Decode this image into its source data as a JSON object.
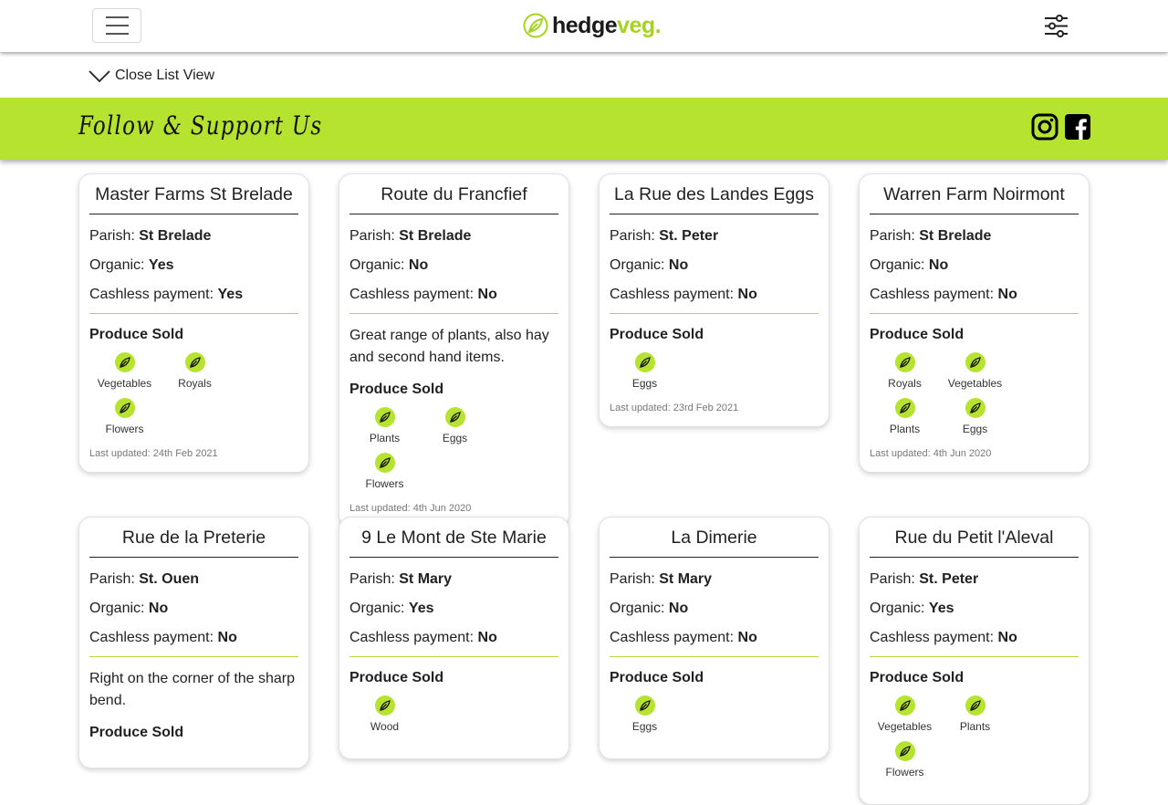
{
  "brand": {
    "hedge": "hedge",
    "veg": "veg."
  },
  "list_toggle": "Close List View",
  "follow": {
    "title": "Follow & Support Us"
  },
  "labels": {
    "parish": "Parish: ",
    "organic": "Organic: ",
    "cashless": "Cashless payment: ",
    "produce": "Produce Sold"
  },
  "colors": {
    "accent": "#b5e32f",
    "logo_green": "#a6d321"
  },
  "cards": [
    {
      "title": "Master Farms St Brelade",
      "parish": "St Brelade",
      "organic": "Yes",
      "cashless": "Yes",
      "produce": [
        "Vegetables",
        "Royals",
        "Flowers"
      ],
      "updated": "Last updated: 24th Feb 2021"
    },
    {
      "title": "Route du Francfief",
      "parish": "St Brelade",
      "organic": "No",
      "cashless": "No",
      "description": "Great range of plants, also hay and second hand items.",
      "produce": [
        "Plants",
        "Eggs",
        "Flowers"
      ],
      "updated": "Last updated: 4th Jun 2020"
    },
    {
      "title": "La Rue des Landes Eggs",
      "parish": "St. Peter",
      "organic": "No",
      "cashless": "No",
      "produce": [
        "Eggs"
      ],
      "updated": "Last updated: 23rd Feb 2021"
    },
    {
      "title": "Warren Farm Noirmont",
      "parish": "St Brelade",
      "organic": "No",
      "cashless": "No",
      "produce": [
        "Royals",
        "Vegetables",
        "Plants",
        "Eggs"
      ],
      "updated": "Last updated: 4th Jun 2020"
    },
    {
      "title": "Rue de la Preterie",
      "parish": "St. Ouen",
      "organic": "No",
      "cashless": "No",
      "description": "Right on the corner of the sharp bend.",
      "produce": [],
      "updated": ""
    },
    {
      "title": "9 Le Mont de Ste Marie",
      "parish": "St Mary",
      "organic": "Yes",
      "cashless": "No",
      "produce": [
        "Wood"
      ],
      "updated": ""
    },
    {
      "title": "La Dimerie",
      "parish": "St Mary",
      "organic": "No",
      "cashless": "No",
      "produce": [
        "Eggs"
      ],
      "updated": ""
    },
    {
      "title": "Rue du Petit l'Aleval",
      "parish": "St. Peter",
      "organic": "Yes",
      "cashless": "No",
      "produce": [
        "Vegetables",
        "Plants",
        "Flowers"
      ],
      "updated": ""
    }
  ]
}
